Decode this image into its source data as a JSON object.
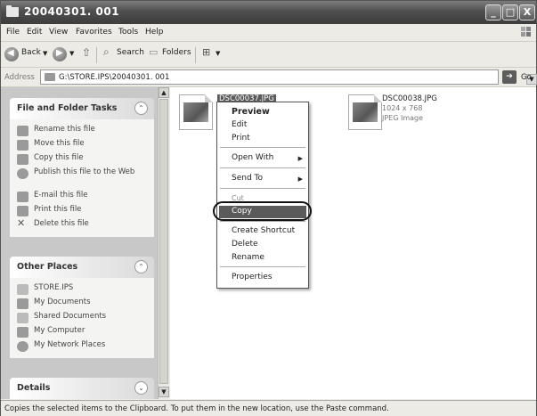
{
  "window": {
    "title": "20040301. 001",
    "min_label": "_",
    "max_label": "□",
    "close_label": "X"
  },
  "menu": [
    "File",
    "Edit",
    "View",
    "Favorites",
    "Tools",
    "Help"
  ],
  "toolbar": {
    "back_label": "Back",
    "search_label": "Search",
    "folders_label": "Folders"
  },
  "address": {
    "label": "Address",
    "path": "G:\\STORE.IPS\\20040301. 001",
    "go_label": "Go"
  },
  "file_tasks": {
    "title": "File and Folder Tasks",
    "items": [
      "Rename this file",
      "Move this file",
      "Copy this file",
      "Publish this file to the Web",
      "E-mail this file",
      "Print this file",
      "Delete this file"
    ]
  },
  "other_places": {
    "title": "Other Places",
    "items": [
      "STORE.IPS",
      "My Documents",
      "Shared Documents",
      "My Computer",
      "My Network Places"
    ]
  },
  "details": {
    "title": "Details"
  },
  "files": [
    {
      "name": "DSC00037.JPG"
    },
    {
      "name": "DSC00038.JPG",
      "dims": "1024 x 768",
      "type": "JPEG Image"
    }
  ],
  "context_menu": {
    "preview": "Preview",
    "edit": "Edit",
    "print": "Print",
    "open_with": "Open With",
    "send_to": "Send To",
    "cut": "Cut",
    "copy": "Copy",
    "create_shortcut": "Create Shortcut",
    "delete": "Delete",
    "rename": "Rename",
    "properties": "Properties"
  },
  "status": "Copies the selected items to the Clipboard. To put them in the new location, use the Paste command.",
  "colors": {
    "titlebar": "#4e4e4e",
    "highlight": "#5a5a5a",
    "sidebar": "#c8c8c8"
  }
}
